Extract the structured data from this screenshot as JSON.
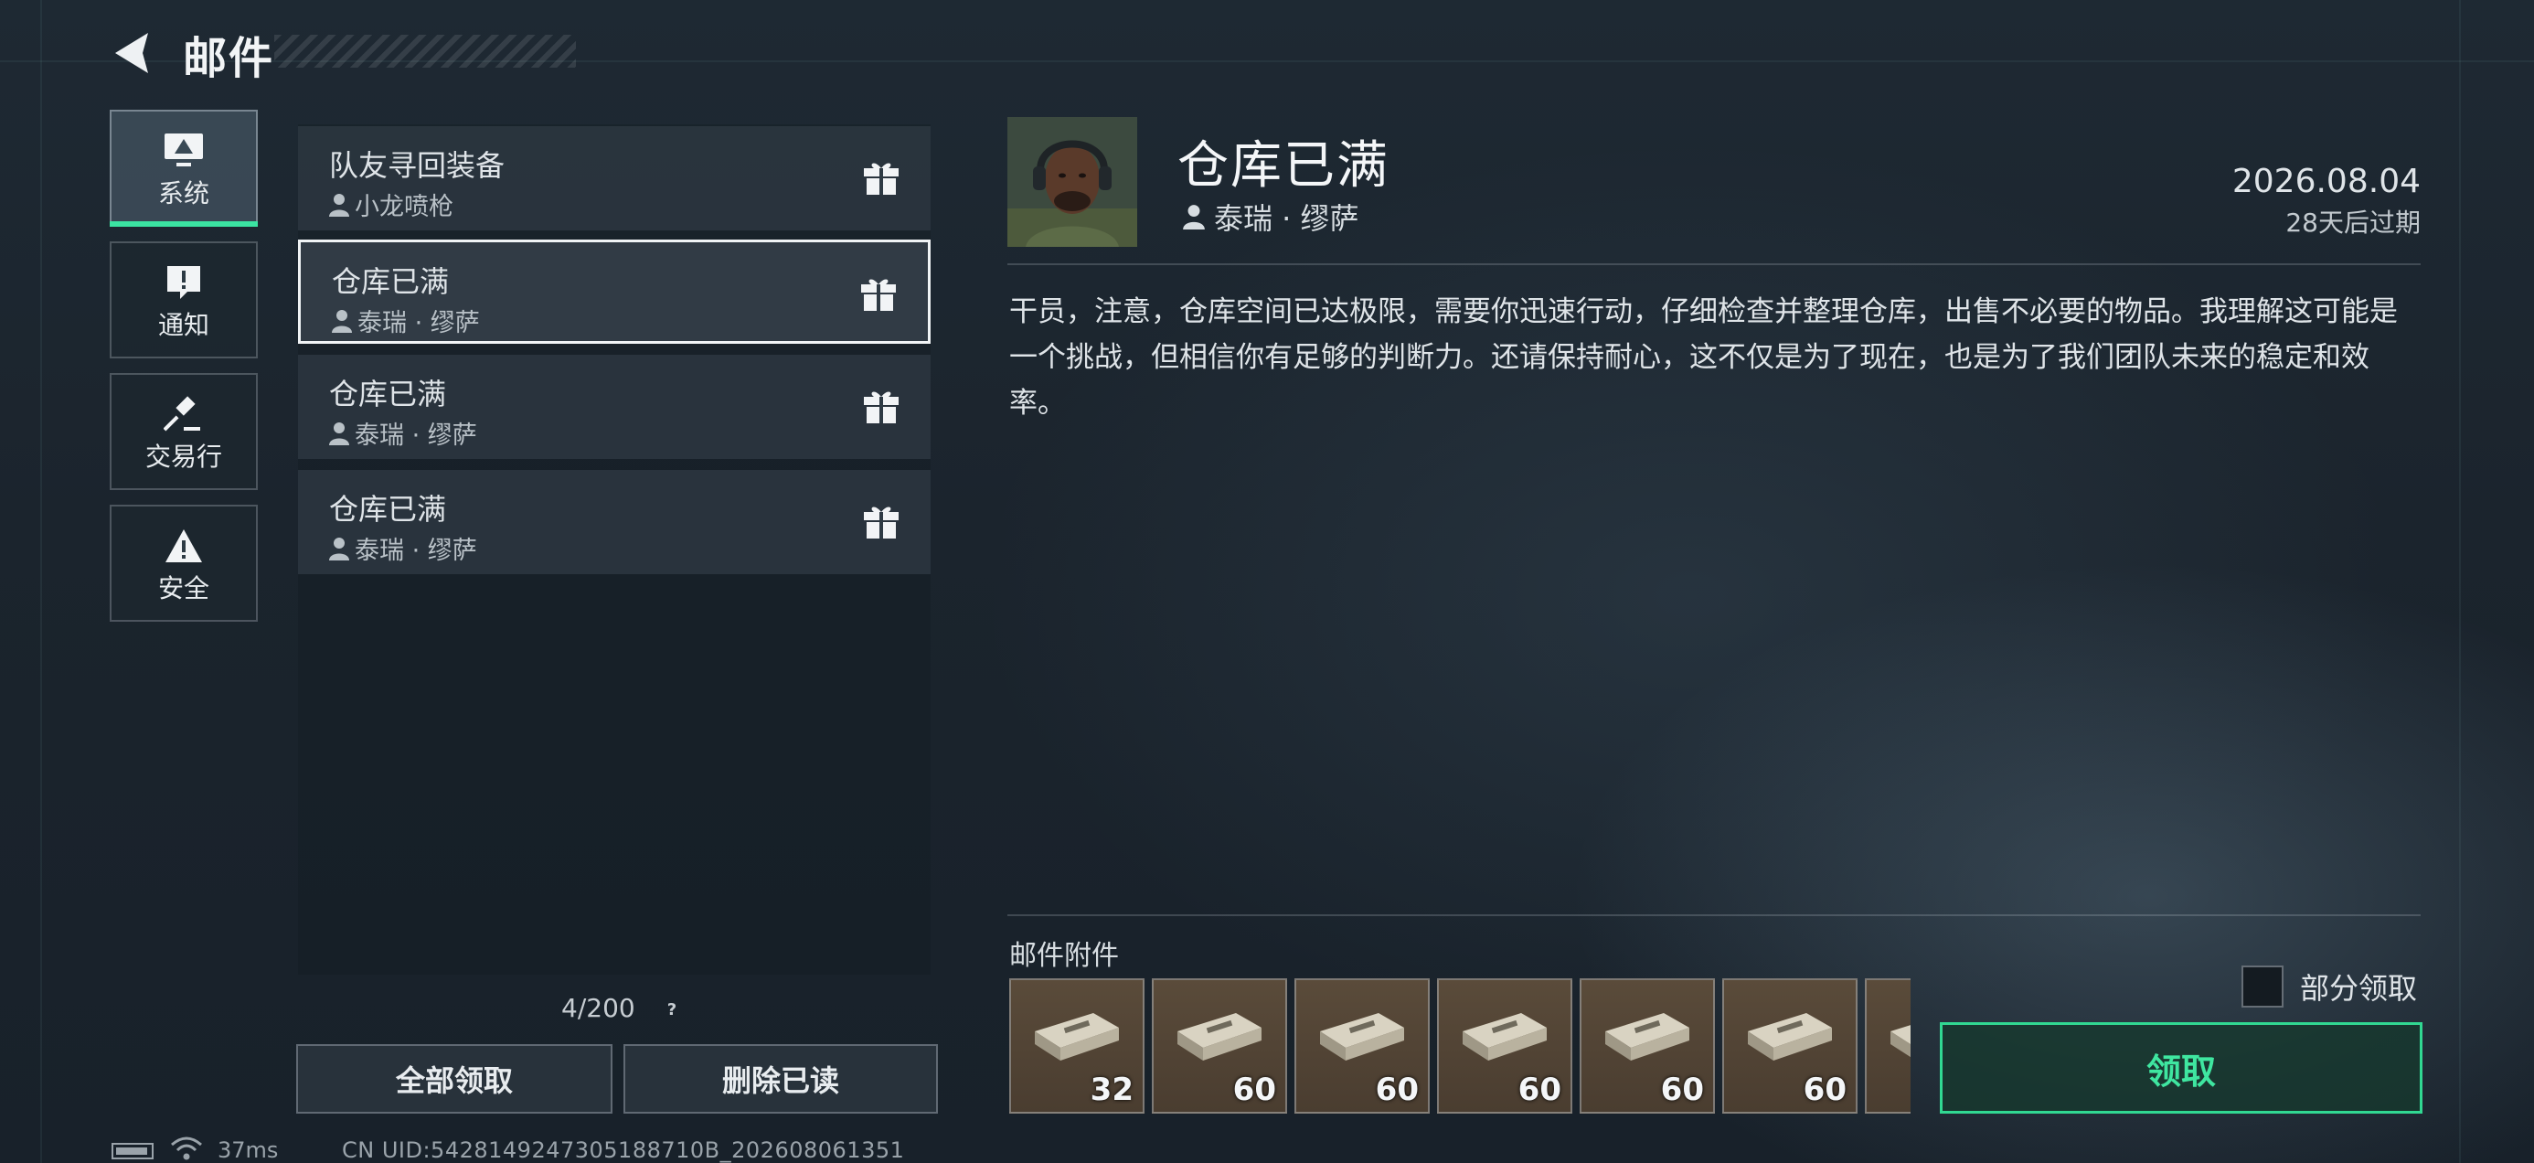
{
  "header": {
    "title": "邮件"
  },
  "sidebar": {
    "items": [
      {
        "label": "系统",
        "icon": "monitor-icon",
        "active": true
      },
      {
        "label": "通知",
        "icon": "alert-bubble-icon",
        "active": false
      },
      {
        "label": "交易行",
        "icon": "gavel-icon",
        "active": false
      },
      {
        "label": "安全",
        "icon": "warning-triangle-icon",
        "active": false
      }
    ]
  },
  "mails": [
    {
      "subject": "队友寻回装备",
      "sender": "小龙喷枪",
      "selected": false
    },
    {
      "subject": "仓库已满",
      "sender": "泰瑞 · 缪萨",
      "selected": true
    },
    {
      "subject": "仓库已满",
      "sender": "泰瑞 · 缪萨",
      "selected": false
    },
    {
      "subject": "仓库已满",
      "sender": "泰瑞 · 缪萨",
      "selected": false
    }
  ],
  "mail_count": "4/200",
  "help_glyph": "?",
  "buttons": {
    "claim_all": "全部领取",
    "delete_read": "删除已读"
  },
  "status": {
    "ping": "37ms",
    "uid": "CN UID:5428149247305188710B_202608061351"
  },
  "detail": {
    "title": "仓库已满",
    "sender": "泰瑞 · 缪萨",
    "date": "2026.08.04",
    "expire": "28天后过期",
    "body": "干员，注意，仓库空间已达极限，需要你迅速行动，仔细检查并整理仓库，出售不必要的物品。我理解这可能是一个挑战，但相信你有足够的判断力。还请保持耐心，这不仅是为了现在，也是为了我们团队未来的稳定和效率。",
    "attachments_label": "邮件附件",
    "attachments": [
      {
        "icon": "ammo-box-icon",
        "qty": "32"
      },
      {
        "icon": "ammo-box-icon",
        "qty": "60"
      },
      {
        "icon": "ammo-box-icon",
        "qty": "60"
      },
      {
        "icon": "ammo-box-icon",
        "qty": "60"
      },
      {
        "icon": "ammo-box-icon",
        "qty": "60"
      },
      {
        "icon": "ammo-box-icon",
        "qty": "60"
      },
      {
        "icon": "ammo-box-icon",
        "qty": ""
      }
    ],
    "partial_claim_label": "部分领取",
    "claim_label": "领取"
  },
  "colors": {
    "accent": "#3be4a2",
    "claim_border": "#31d892"
  }
}
